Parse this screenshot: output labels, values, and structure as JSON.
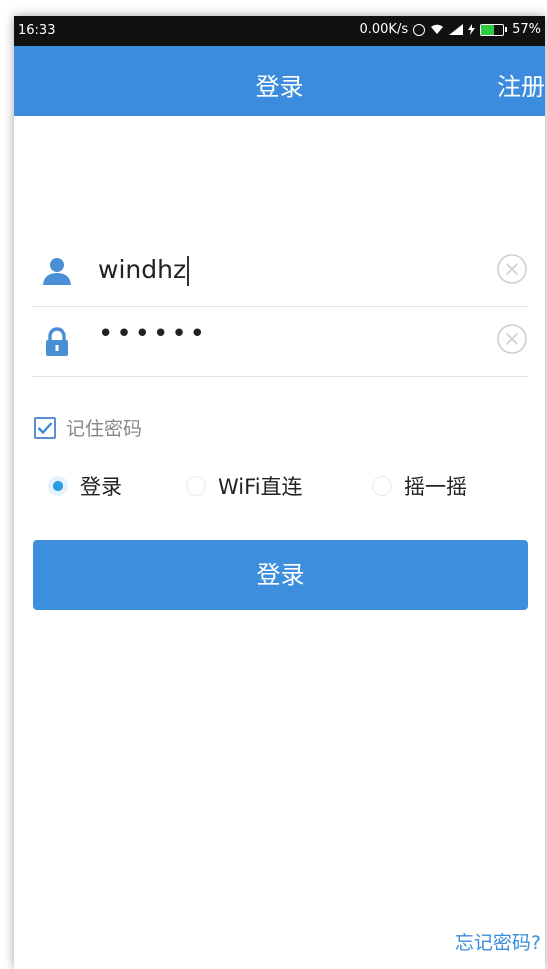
{
  "status_bar": {
    "time": "16:33",
    "net_speed": "0.00K/s",
    "battery": "57%",
    "battery_level": 0.57,
    "icons": [
      "alarm-icon",
      "wifi-icon",
      "signal-icon",
      "charging-icon",
      "battery-icon"
    ]
  },
  "header": {
    "title": "登录",
    "register_label": "注册",
    "color": "#3b8cdc"
  },
  "form": {
    "username": {
      "icon": "user-icon",
      "value": "windhz"
    },
    "password": {
      "icon": "lock-icon",
      "value": "••••••"
    },
    "clear_icon": "clear-circle-icon",
    "remember_label": "记住密码",
    "remember_checked": true
  },
  "mode_options": [
    {
      "label": "登录",
      "selected": true
    },
    {
      "label": "WiFi直连",
      "selected": false
    },
    {
      "label": "摇一摇",
      "selected": false
    }
  ],
  "login_button_label": "登录",
  "forgot_password_label": "忘记密码?",
  "colors": {
    "accent": "#3b8cdc",
    "radio_active": "#2a9ce6",
    "battery_fill": "#2ecc40"
  }
}
